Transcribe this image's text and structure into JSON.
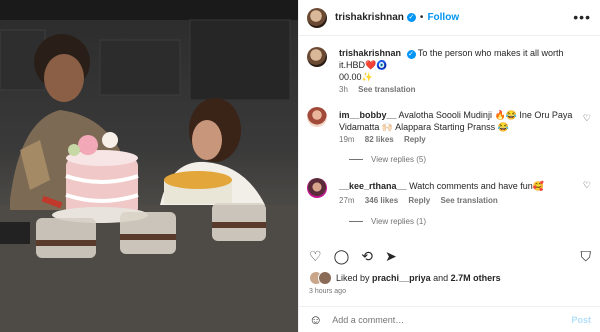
{
  "post": {
    "username": "trishakrishnan",
    "verified": true,
    "follow_label": "Follow",
    "separator": "•",
    "more_label": "•••"
  },
  "caption": {
    "username": "trishakrishnan",
    "text": "To the person who makes it all worth it.HBD❤️🧿",
    "text2": "00.00✨",
    "time": "3h",
    "see_translation": "See translation"
  },
  "comments": [
    {
      "username": "im__bobby__",
      "text": "Avalotha Soooli Mudinji 🔥😂 Ine Oru Paya Vidamatta 🙌🏻 Alappara Starting Pranss 😂",
      "time": "19m",
      "likes": "82 likes",
      "reply": "Reply",
      "view_replies": "View replies (5)"
    },
    {
      "username": "__kee_rthana__",
      "text": "Watch comments and have fun🥰",
      "time": "27m",
      "likes": "346 likes",
      "reply": "Reply",
      "see_translation": "See translation",
      "view_replies": "View replies (1)"
    }
  ],
  "likes": {
    "prefix": "Liked by",
    "user": "prachi__priya",
    "mid": "and",
    "others": "2.7M others"
  },
  "time_ago": "3 hours ago",
  "add_comment": {
    "placeholder": "Add a comment…",
    "post_label": "Post"
  },
  "icons": [
    "heart-icon",
    "comment-icon",
    "share-icon",
    "send-icon",
    "bookmark-icon",
    "emoji-icon"
  ]
}
